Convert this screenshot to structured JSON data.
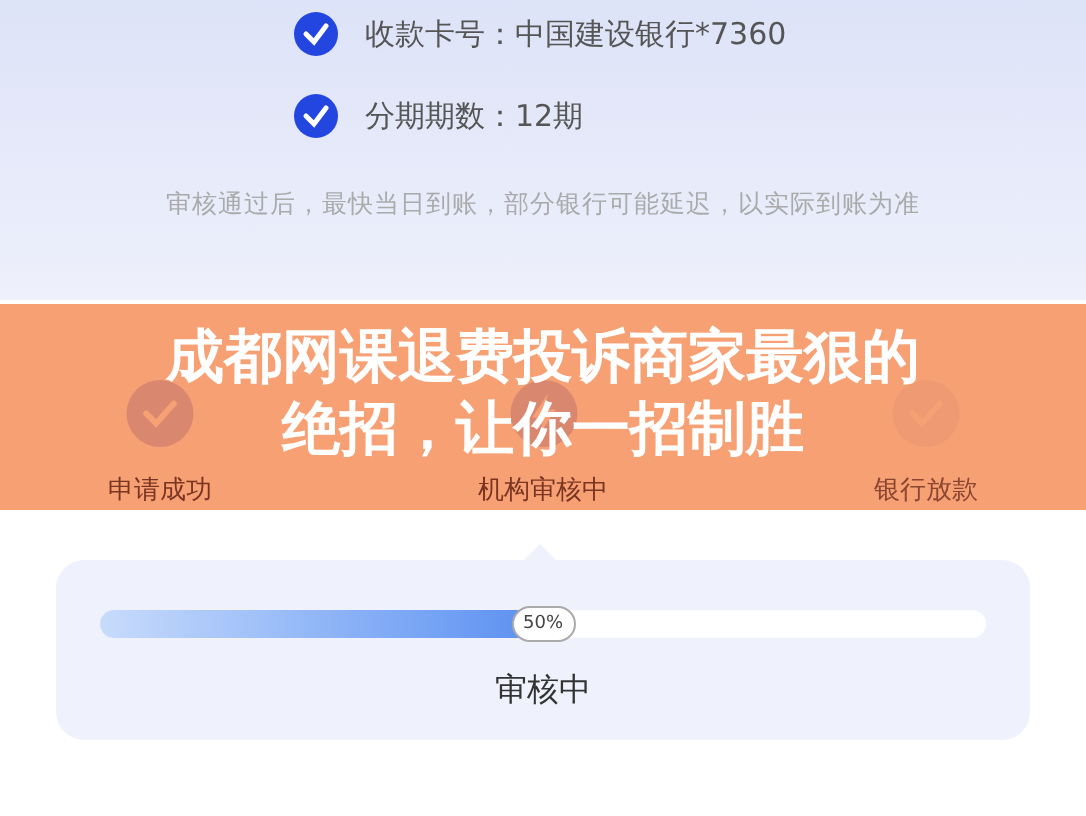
{
  "checks": [
    {
      "text": "收款卡号：中国建设银行*7360",
      "checked": true
    },
    {
      "text": "分期期数：12期",
      "checked": true
    }
  ],
  "note": "审核通过后，最快当日到账，部分银行可能延迟，以实际到账为准",
  "steps": [
    {
      "label": "申请成功",
      "kind": "done"
    },
    {
      "label": "机构审核中",
      "kind": "current"
    },
    {
      "label": "银行放款",
      "kind": "pending"
    }
  ],
  "progress": {
    "level": 0.5,
    "reading": "50%",
    "status": "审核中"
  },
  "banner": {
    "title": "成都网课退费投诉商家最狠的绝招，让你一招制胜"
  }
}
